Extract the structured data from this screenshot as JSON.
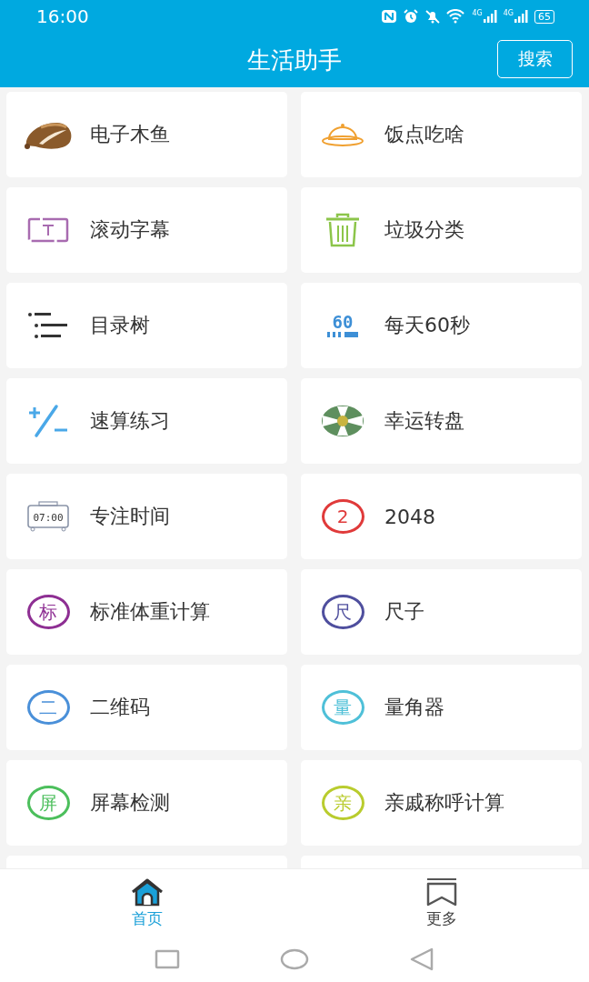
{
  "status_bar": {
    "time": "16:00",
    "networks": [
      "4G",
      "4G"
    ],
    "battery": "65"
  },
  "app_bar": {
    "title": "生活助手",
    "action": "搜索"
  },
  "tools": [
    {
      "label": "电子木鱼",
      "kind": "fish"
    },
    {
      "label": "饭点吃啥",
      "kind": "cloche"
    },
    {
      "label": "滚动字幕",
      "kind": "marquee"
    },
    {
      "label": "垃圾分类",
      "kind": "trash"
    },
    {
      "label": "目录树",
      "kind": "list"
    },
    {
      "label": "每天60秒",
      "kind": "digits",
      "badge": "60"
    },
    {
      "label": "速算练习",
      "kind": "plusminus"
    },
    {
      "label": "幸运转盘",
      "kind": "wheel"
    },
    {
      "label": "专注时间",
      "kind": "clock",
      "badge": "07:00"
    },
    {
      "label": "2048",
      "kind": "circle",
      "badge": "2",
      "color": "#e03a3a"
    },
    {
      "label": "标准体重计算",
      "kind": "circle",
      "badge": "标",
      "color": "#8e2f93"
    },
    {
      "label": "尺子",
      "kind": "circle",
      "badge": "尺",
      "color": "#4f4f9e"
    },
    {
      "label": "二维码",
      "kind": "circle",
      "badge": "二",
      "color": "#4a90d9"
    },
    {
      "label": "量角器",
      "kind": "circle",
      "badge": "量",
      "color": "#4fc0d8"
    },
    {
      "label": "屏幕检测",
      "kind": "circle",
      "badge": "屏",
      "color": "#4cbf5c"
    },
    {
      "label": "亲戚称呼计算",
      "kind": "circle",
      "badge": "亲",
      "color": "#b9cc2e"
    }
  ],
  "bottom_nav": [
    {
      "label": "首页",
      "kind": "home",
      "selected": true
    },
    {
      "label": "更多",
      "kind": "bookmark",
      "selected": false
    }
  ]
}
